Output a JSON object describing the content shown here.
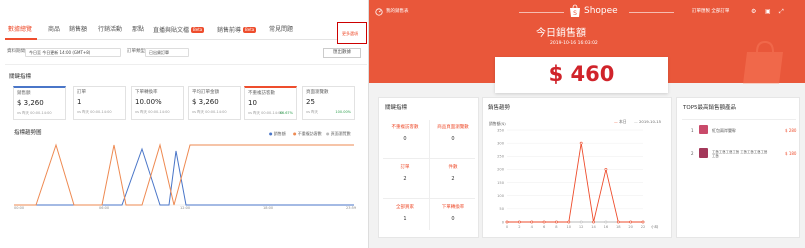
{
  "left": {
    "tabs": [
      {
        "label": "數據總覽",
        "active": true
      },
      {
        "label": "商品",
        "active": false
      },
      {
        "label": "銷售額",
        "active": false
      },
      {
        "label": "行銷活動",
        "active": false
      },
      {
        "label": "那點",
        "active": false
      },
      {
        "label": "直播與貼文檔",
        "badge": "Beta",
        "active": false
      },
      {
        "label": "銷售前導",
        "badge": "Beta",
        "active": false
      },
      {
        "label": "常見問題",
        "active": false
      }
    ],
    "more_tab": "更多選項",
    "filters": {
      "period_label": "資料期間",
      "period_value": "今日至 今日更新 14:00 (GMT+8)",
      "order_label": "訂單類型",
      "order_value": "已出貨訂單",
      "export_label": "匯出數據"
    },
    "metrics_title": "關鍵指標",
    "cards": [
      {
        "label": "銷售額",
        "value": "$ 3,260",
        "compare": "vs 昨天 00:00-14:00",
        "pct": "",
        "color": "#4a76c8"
      },
      {
        "label": "訂單",
        "value": "1",
        "compare": "vs 昨天 00:00-14:00",
        "pct": "",
        "color": ""
      },
      {
        "label": "下單轉換率",
        "value": "10.00%",
        "compare": "vs 昨天 00:00-14:00",
        "pct": "",
        "color": ""
      },
      {
        "label": "平均訂單金額",
        "value": "$ 3,260",
        "compare": "vs 昨天 00:00-14:00",
        "pct": "",
        "color": ""
      },
      {
        "label": "不重複訪客數",
        "value": "10",
        "compare": "vs 昨天 00:00-14:00",
        "pct": "66.67%",
        "color": "#ee4d2d"
      },
      {
        "label": "頁面瀏覽數",
        "value": "25",
        "compare": "vs 昨天",
        "pct": "100.00%",
        "color": ""
      }
    ],
    "trend_title": "指標趨勢圖",
    "legend": [
      "銷售額",
      "不重複訪客數",
      "頁面瀏覽數"
    ],
    "x_ticks": [
      "00:00",
      "06:00",
      "12:00",
      "18:00",
      "23:59"
    ]
  },
  "right": {
    "header_left": "我的銷售表",
    "brand": "Shopee",
    "header_right": "訂單匯製  全部訂單",
    "title": "今日銷售額",
    "datetime": "2019-10-16 16:03:02",
    "big_value": "$ 460",
    "key_title": "關鍵指標",
    "key_items": [
      {
        "label": "不重複訪客數",
        "value": "0"
      },
      {
        "label": "商品頁面瀏覽數",
        "value": "0"
      },
      {
        "label": "訂單",
        "value": "2"
      },
      {
        "label": "件數",
        "value": "2"
      },
      {
        "label": "全部買家",
        "value": "1"
      },
      {
        "label": "下單轉換率",
        "value": "0"
      }
    ],
    "trend_title": "銷售趨勢",
    "trend_ylabel": "銷售額($)",
    "trend_legend": [
      "本日",
      "2019-10-15"
    ],
    "trend_xlabel": "小時",
    "top_title": "TOP5最高銷售額產品",
    "products": [
      {
        "rank": "1",
        "name": "紅包兩岸嬰幹",
        "price": "$ 280"
      },
      {
        "rank": "2",
        "name": "工藝工藝工藝工藝 工藝工藝工藝工藝工藝",
        "price": "$ 180"
      }
    ],
    "colors": {
      "accent": "#ee4d2d",
      "header": "#e9573a"
    }
  },
  "chart_data": [
    {
      "type": "line",
      "title": "銷售趨勢",
      "ylabel": "銷售額($)",
      "xlabel": "小時",
      "x": [
        0,
        2,
        4,
        6,
        8,
        10,
        12,
        14,
        16,
        18,
        20,
        22
      ],
      "ylim": [
        0,
        350
      ],
      "yticks": [
        0,
        50,
        100,
        150,
        200,
        250,
        300,
        350
      ],
      "series": [
        {
          "name": "本日",
          "values": [
            0,
            0,
            0,
            0,
            0,
            0,
            300,
            0,
            200,
            0,
            0,
            0
          ]
        },
        {
          "name": "2019-10-15",
          "values": [
            0,
            0,
            0,
            0,
            0,
            0,
            0,
            0,
            0,
            0,
            0,
            0
          ]
        }
      ]
    }
  ]
}
